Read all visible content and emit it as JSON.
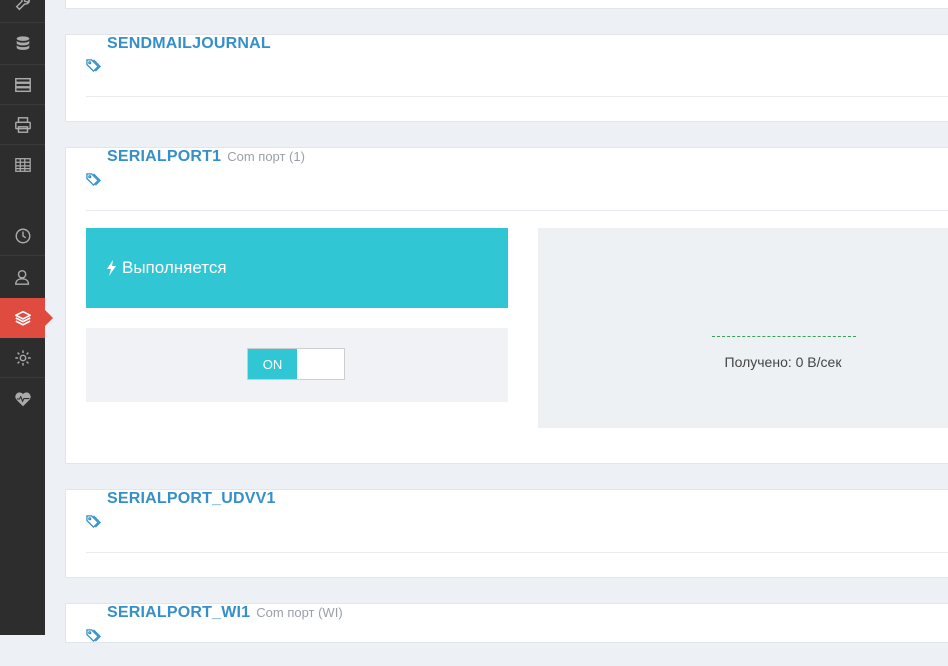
{
  "sidebar": {
    "icons": [
      "wrench-icon",
      "database-icon",
      "server-icon",
      "printer-icon",
      "table-icon",
      "clock-icon",
      "users-icon",
      "layers-icon",
      "gear-icon",
      "heartbeat-icon"
    ],
    "active": "layers-icon"
  },
  "panels": [
    {
      "title": "SENDMAILJOURNAL",
      "subtitle": ""
    },
    {
      "title": "SERIALPORT1",
      "subtitle": "Com порт (1)"
    },
    {
      "title": "SERIALPORT_UDVV1",
      "subtitle": ""
    },
    {
      "title": "SERIALPORT_WI1",
      "subtitle": "Com порт (WI)"
    }
  ],
  "serialport1": {
    "status_label": "Выполняется",
    "toggle_label": "ON",
    "received_label": "Получено: 0 B/сек"
  },
  "colors": {
    "accent": "#31c6d4",
    "title": "#3590c9",
    "active_nav": "#e04b3f",
    "sidebar": "#2d2d2d"
  }
}
